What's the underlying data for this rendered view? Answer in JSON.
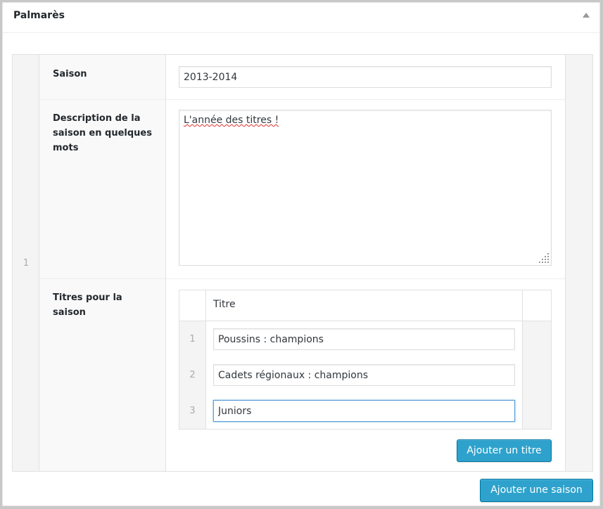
{
  "panel": {
    "title": "Palmarès"
  },
  "season_row": {
    "number": "1",
    "season_label": "Saison",
    "season_value": "2013-2014",
    "description_label": "Description de la saison en quelques mots",
    "description_value": "L'année des titres !",
    "titles_label": "Titres pour la saison",
    "titles_table": {
      "header": "Titre",
      "rows": [
        {
          "number": "1",
          "value": "Poussins : champions"
        },
        {
          "number": "2",
          "value": "Cadets régionaux : champions"
        },
        {
          "number": "3",
          "value": "Juniors"
        }
      ]
    },
    "add_title_button": "Ajouter un titre"
  },
  "add_season_button": "Ajouter une saison",
  "colors": {
    "button": "#2ea2cc",
    "button_border": "#0074a2",
    "spellcheck_underline": "#e0302e",
    "focus_border": "#5b9dd9"
  }
}
